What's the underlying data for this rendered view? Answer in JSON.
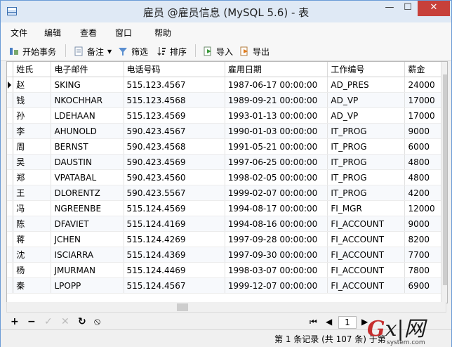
{
  "window": {
    "title": "雇员 @雇员信息 (MySQL 5.6) - 表"
  },
  "titlebar": {
    "min": "—",
    "max": "☐",
    "close": "✕"
  },
  "menu": [
    "文件",
    "编辑",
    "查看",
    "窗口",
    "帮助"
  ],
  "toolbar": {
    "begin_transaction": "开始事务",
    "note": "备注",
    "filter": "筛选",
    "sort": "排序",
    "import": "导入",
    "export": "导出"
  },
  "table": {
    "columns": [
      "姓氏",
      "电子邮件",
      "电话号码",
      "雇用日期",
      "工作编号",
      "薪金"
    ],
    "rows": [
      [
        "赵",
        "SKING",
        "515.123.4567",
        "1987-06-17 00:00:00",
        "AD_PRES",
        "24000"
      ],
      [
        "钱",
        "NKOCHHAR",
        "515.123.4568",
        "1989-09-21 00:00:00",
        "AD_VP",
        "17000"
      ],
      [
        "孙",
        "LDEHAAN",
        "515.123.4569",
        "1993-01-13 00:00:00",
        "AD_VP",
        "17000"
      ],
      [
        "李",
        "AHUNOLD",
        "590.423.4567",
        "1990-01-03 00:00:00",
        "IT_PROG",
        "9000"
      ],
      [
        "周",
        "BERNST",
        "590.423.4568",
        "1991-05-21 00:00:00",
        "IT_PROG",
        "6000"
      ],
      [
        "吴",
        "DAUSTIN",
        "590.423.4569",
        "1997-06-25 00:00:00",
        "IT_PROG",
        "4800"
      ],
      [
        "郑",
        "VPATABAL",
        "590.423.4560",
        "1998-02-05 00:00:00",
        "IT_PROG",
        "4800"
      ],
      [
        "王",
        "DLORENTZ",
        "590.423.5567",
        "1999-02-07 00:00:00",
        "IT_PROG",
        "4200"
      ],
      [
        "冯",
        "NGREENBE",
        "515.124.4569",
        "1994-08-17 00:00:00",
        "FI_MGR",
        "12000"
      ],
      [
        "陈",
        "DFAVIET",
        "515.124.4169",
        "1994-08-16 00:00:00",
        "FI_ACCOUNT",
        "9000"
      ],
      [
        "蒋",
        "JCHEN",
        "515.124.4269",
        "1997-09-28 00:00:00",
        "FI_ACCOUNT",
        "8200"
      ],
      [
        "沈",
        "ISCIARRA",
        "515.124.4369",
        "1997-09-30 00:00:00",
        "FI_ACCOUNT",
        "7700"
      ],
      [
        "杨",
        "JMURMAN",
        "515.124.4469",
        "1998-03-07 00:00:00",
        "FI_ACCOUNT",
        "7800"
      ],
      [
        "秦",
        "LPOPP",
        "515.124.4567",
        "1999-12-07 00:00:00",
        "FI_ACCOUNT",
        "6900"
      ]
    ]
  },
  "nav": {
    "add": "+",
    "delete": "−",
    "apply": "✓",
    "cancel": "✕",
    "refresh": "↻",
    "stop": "⦸",
    "first": "⏮",
    "prev": "◀",
    "page": "1",
    "next": "▶"
  },
  "status": {
    "text": "第 1 条记录 (共 107 条) 于第"
  },
  "watermark": {
    "logo_g": "G",
    "logo_rest": "x|网",
    "site": "system.com"
  }
}
